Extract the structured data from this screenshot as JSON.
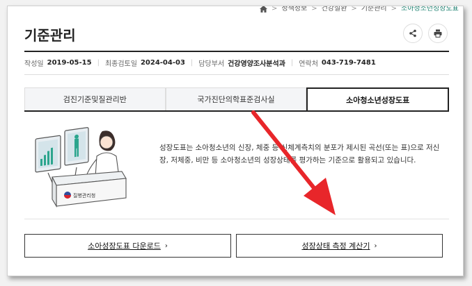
{
  "breadcrumb": {
    "items": [
      "정책정보",
      "건강질환",
      "기준관리"
    ],
    "current": "소아청소년성장도표"
  },
  "page": {
    "title": "기준관리"
  },
  "meta": {
    "created_label": "작성일",
    "created": "2019-05-15",
    "reviewed_label": "최종검토일",
    "reviewed": "2024-04-03",
    "dept_label": "담당부서",
    "dept": "건강영양조사분석과",
    "contact_label": "연락처",
    "contact": "043-719-7481"
  },
  "tabs": [
    {
      "label": "검진기준및질관리반",
      "active": false
    },
    {
      "label": "국가진단의학표준검사실",
      "active": false
    },
    {
      "label": "소아청소년성장도표",
      "active": true
    }
  ],
  "content": {
    "description": "성장도표는 소아청소년의 신장, 체중 등 신체계측치의 분포가 제시된 곡선(또는 표)으로 저신장, 저체중, 비만 등 소아청소년의 성장상태를 평가하는 기준으로 활용되고 있습니다.",
    "illustration_sign": "질병관리청"
  },
  "buttons": {
    "download": "소아성장도표 다운로드",
    "calculator": "성장상태 측정 계산기",
    "chevron": "›"
  },
  "icons": {
    "home": "home-icon",
    "share": "share-icon",
    "print": "print-icon"
  },
  "colors": {
    "accent": "#1a7f6e",
    "arrow": "#e8262a"
  }
}
